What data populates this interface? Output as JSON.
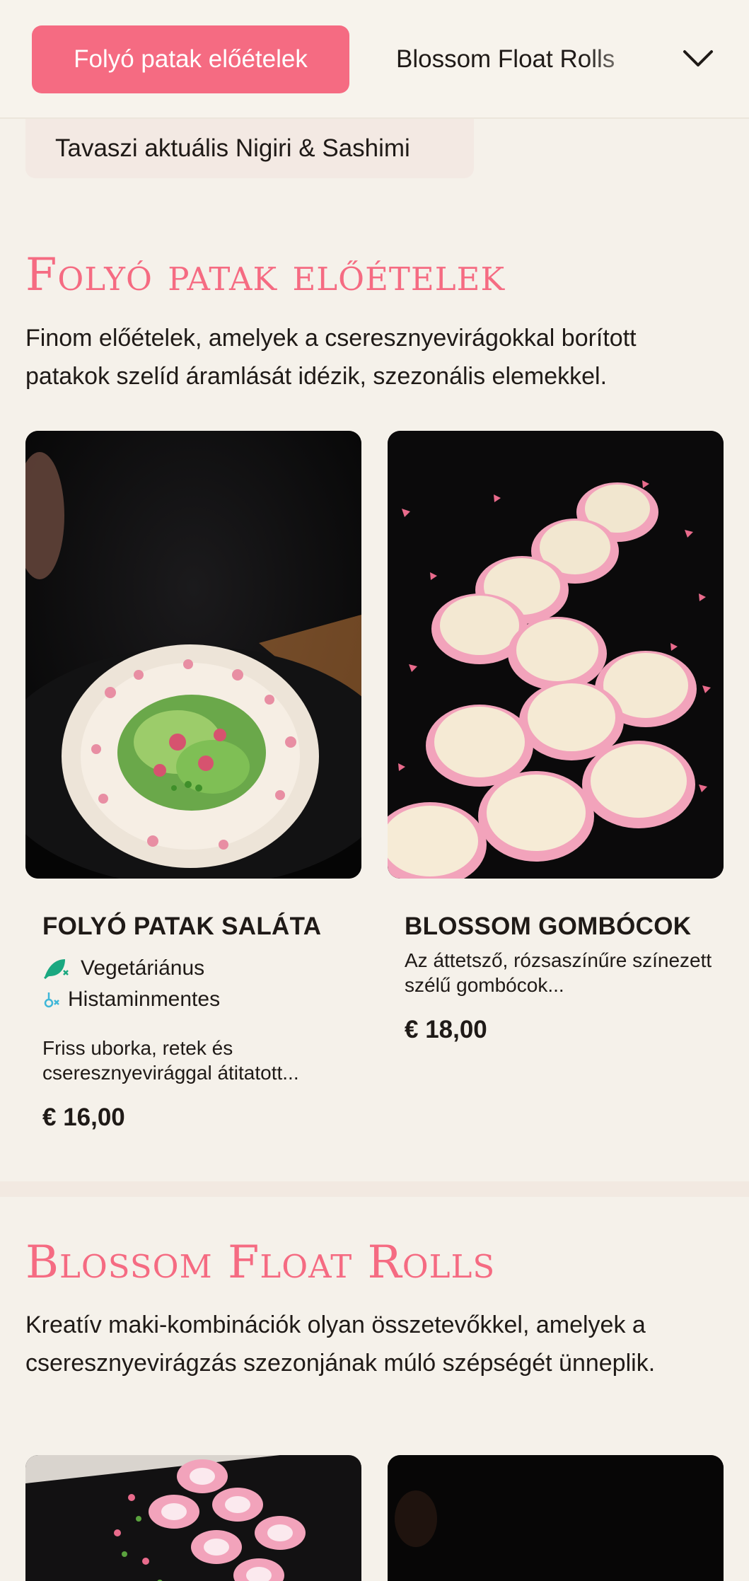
{
  "nav": {
    "active_category": "Folyó patak előételek",
    "next_category": "Blossom Float Rolls",
    "second_row_category": "Tavaszi aktuális Nigiri & Sashimi"
  },
  "sections": [
    {
      "title": "Folyó patak előételek",
      "description": "Finom előételek, amelyek a cseresznyevirágokkal borított patakok szelíd áramlását idézik, szezonális elemekkel.",
      "items": [
        {
          "name": "FOLYÓ PATAK SALÁTA",
          "tags": [
            "Vegetáriánus",
            "Histaminmentes"
          ],
          "description": "Friss uborka, retek és cseresznyevirággal átitatott...",
          "price": "€ 16,00"
        },
        {
          "name": "BLOSSOM GOMBÓCOK",
          "description": "Az áttetsző, rózsaszínűre színezett szélű gombócok...",
          "price": "€ 18,00"
        }
      ]
    },
    {
      "title": "Blossom Float Rolls",
      "description": "Kreatív maki-kombinációk olyan összetevőkkel, amelyek a cseresznyevirágzás szezonjának múló szépségét ünneplik."
    }
  ],
  "colors": {
    "accent": "#f56b82",
    "background": "#f5f1ea",
    "vegetarian_icon": "#1aa880",
    "histamine_icon": "#3fb7d8"
  },
  "icons": {
    "expand": "chevron-down-icon",
    "vegetarian": "leaf-icon",
    "histamine": "histamine-free-icon"
  }
}
